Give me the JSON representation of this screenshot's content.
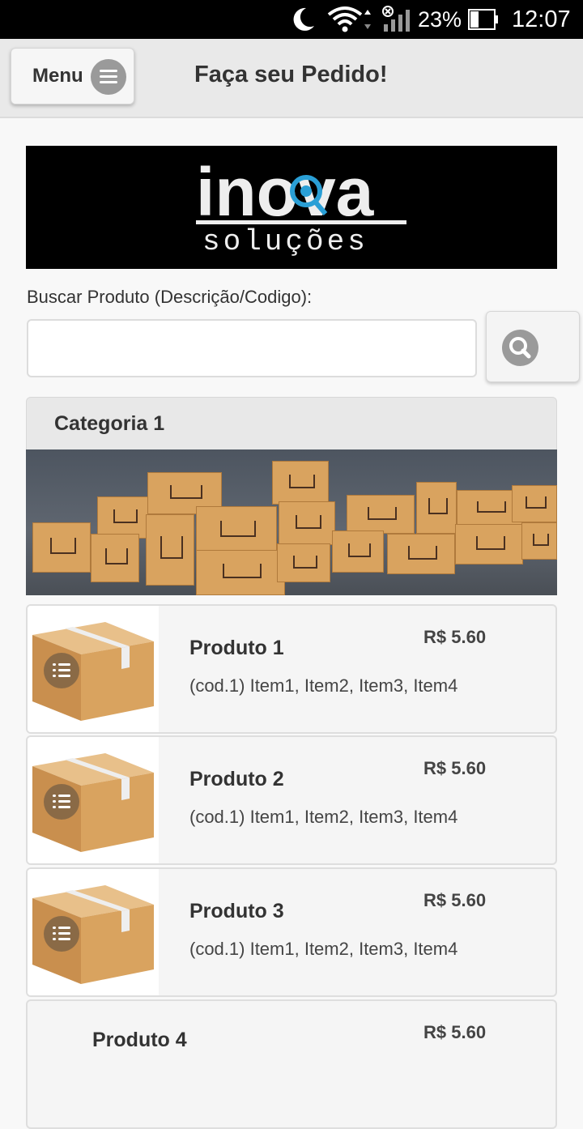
{
  "status_bar": {
    "battery_percent": "23%",
    "time": "12:07",
    "icons": [
      "moon-icon",
      "wifi-icon",
      "signal-icon",
      "battery-icon"
    ]
  },
  "header": {
    "menu_label": "Menu",
    "title": "Faça seu Pedido!"
  },
  "logo": {
    "brand_line1": "inova",
    "brand_line2": "soluções"
  },
  "search": {
    "label": "Buscar Produto (Descrição/Codigo):",
    "value": "",
    "placeholder": ""
  },
  "category": {
    "title": "Categoria 1"
  },
  "products": [
    {
      "name": "Produto 1",
      "price": "R$ 5.60",
      "description": "(cod.1) Item1, Item2, Item3, Item4"
    },
    {
      "name": "Produto 2",
      "price": "R$ 5.60",
      "description": "(cod.1) Item1, Item2, Item3, Item4"
    },
    {
      "name": "Produto 3",
      "price": "R$ 5.60",
      "description": "(cod.1) Item1, Item2, Item3, Item4"
    },
    {
      "name": "Produto 4",
      "price": "R$ 5.60",
      "description": ""
    }
  ],
  "colors": {
    "header_bg": "#e9e9e9",
    "icon_gray": "#9a9a9a",
    "list_icon_brown": "#8a6a46",
    "logo_accent": "#2a9fd6",
    "box_brown": "#d9a35f"
  }
}
